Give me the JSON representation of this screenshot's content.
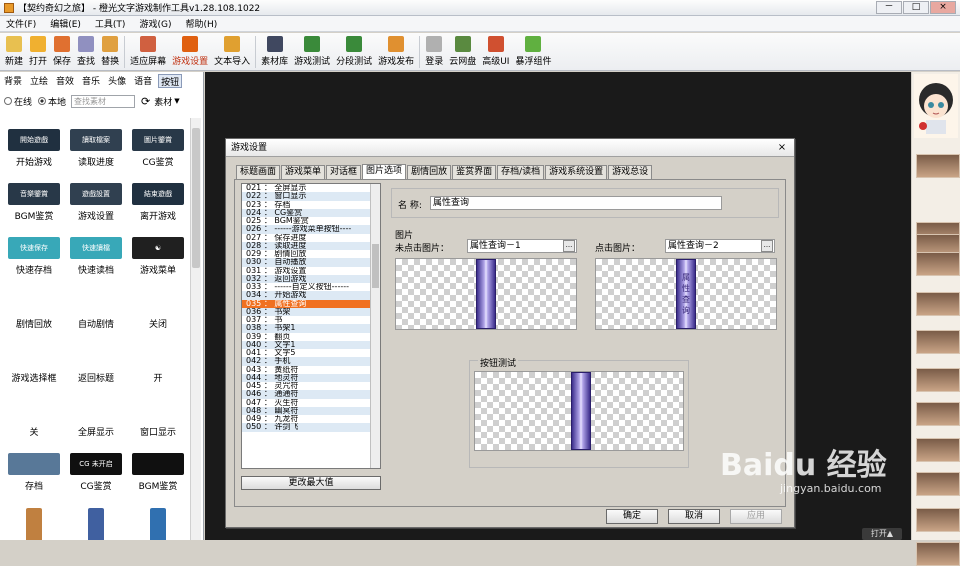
{
  "app": {
    "title": "【契约奇幻之旅】 - 橙光文字游戏制作工具v1.28.108.1022",
    "window_buttons": [
      "－",
      "□",
      "×"
    ]
  },
  "menu": [
    "文件(F)",
    "编辑(E)",
    "工具(T)",
    "游戏(G)",
    "帮助(H)"
  ],
  "toolbar": [
    {
      "label": "新建",
      "icon": "new-file-icon",
      "color": "#e8c050"
    },
    {
      "label": "打开",
      "icon": "open-folder-icon",
      "color": "#f0b030"
    },
    {
      "label": "保存",
      "icon": "save-icon",
      "color": "#e07030"
    },
    {
      "label": "查找",
      "icon": "find-icon",
      "color": "#9090c0"
    },
    {
      "label": "替换",
      "icon": "replace-icon",
      "color": "#e0a040"
    },
    {
      "label": "适应屏幕",
      "icon": "fit-screen-icon",
      "color": "#d06040"
    },
    {
      "label": "游戏设置",
      "icon": "gear-icon",
      "color": "#e06010"
    },
    {
      "label": "文本导入",
      "icon": "text-import-icon",
      "color": "#e0a030"
    },
    {
      "label": "素材库",
      "icon": "asset-library-icon",
      "color": "#404860"
    },
    {
      "label": "游戏测试",
      "icon": "game-test-icon",
      "color": "#3a8a3a"
    },
    {
      "label": "分段测试",
      "icon": "segment-test-icon",
      "color": "#3a8a3a"
    },
    {
      "label": "游戏发布",
      "icon": "publish-icon",
      "color": "#e09030"
    },
    {
      "label": "登录",
      "icon": "login-icon",
      "color": "#b0b0b0"
    },
    {
      "label": "云网盘",
      "icon": "cloud-drive-icon",
      "color": "#5a8a40"
    },
    {
      "label": "高级UI",
      "icon": "advanced-ui-icon",
      "color": "#d05030"
    },
    {
      "label": "暴浮组件",
      "icon": "component-icon",
      "color": "#60b040"
    }
  ],
  "left": {
    "categories": [
      "背景",
      "立绘",
      "音效",
      "音乐",
      "头像",
      "语音",
      "按钮"
    ],
    "active_category": "按钮",
    "source_online": "在线",
    "source_local": "本地",
    "search_placeholder": "查找素材",
    "material_dropdown": "素材",
    "materials": [
      {
        "label": "开始游戏",
        "thumb": "#203040",
        "text": "開始遊戲"
      },
      {
        "label": "读取进度",
        "thumb": "#304050",
        "text": "讀取檔案"
      },
      {
        "label": "CG鉴赏",
        "thumb": "#283848",
        "text": "圖片鑒賞"
      },
      {
        "label": "BGM鉴赏",
        "thumb": "#283848",
        "text": "音樂鑒賞"
      },
      {
        "label": "游戏设置",
        "thumb": "#304050",
        "text": "遊戲設置"
      },
      {
        "label": "离开游戏",
        "thumb": "#203040",
        "text": "結束遊戲"
      },
      {
        "label": "快速存档",
        "thumb": "#38a8b8",
        "text": "快速保存"
      },
      {
        "label": "快速读档",
        "thumb": "#38a8b8",
        "text": "快速讀檔"
      },
      {
        "label": "游戏菜单",
        "thumb": "#202020",
        "text": "☯"
      },
      {
        "label": "剧情回放",
        "thumb": "",
        "text": ""
      },
      {
        "label": "自动剧情",
        "thumb": "",
        "text": ""
      },
      {
        "label": "关闭",
        "thumb": "",
        "text": ""
      },
      {
        "label": "游戏选择框",
        "thumb": "",
        "text": ""
      },
      {
        "label": "返回标题",
        "thumb": "",
        "text": ""
      },
      {
        "label": "开",
        "thumb": "",
        "text": ""
      },
      {
        "label": "关",
        "thumb": "",
        "text": ""
      },
      {
        "label": "全屏显示",
        "thumb": "",
        "text": ""
      },
      {
        "label": "窗口显示",
        "thumb": "",
        "text": ""
      },
      {
        "label": "存档",
        "thumb": "#587898",
        "text": ""
      },
      {
        "label": "CG鉴赏",
        "thumb": "#101010",
        "text": "CG 未开启"
      },
      {
        "label": "BGM鉴赏",
        "thumb": "#101010",
        "text": ""
      },
      {
        "label": "",
        "thumb": "#c08040",
        "text": ""
      },
      {
        "label": "",
        "thumb": "#4060a0",
        "text": ""
      },
      {
        "label": "",
        "thumb": "#3070b0",
        "text": ""
      }
    ]
  },
  "dialog": {
    "title": "游戏设置",
    "close": "×",
    "tabs": [
      "标题画面",
      "游戏菜单",
      "对话框",
      "图片选项",
      "剧情回放",
      "鉴赏界面",
      "存档/读档",
      "游戏系统设置",
      "游戏总设"
    ],
    "active_tab": "图片选项",
    "list": [
      "021 ： 全屏显示",
      "022 ： 窗口显示",
      "023 ： 存档",
      "024 ： CG鉴赏",
      "025 ： BGM鉴赏",
      "026 ： ------游戏菜单按钮----",
      "027 ： 保存进度",
      "028 ： 读取进度",
      "029 ： 剧情回放",
      "030 ： 自动播放",
      "031 ： 游戏设置",
      "032 ： 返回游戏",
      "033 ： ------自定义按钮------",
      "034 ： 开始游戏",
      "035 ： 属性查询",
      "036 ： 书架",
      "037 ： 书",
      "038 ： 书架1",
      "039 ： 翻页",
      "040 ： 文字1",
      "041 ： 文字5",
      "042 ： 手机",
      "043 ： 黄纸符",
      "044 ： 地灵符",
      "045 ： 灵咒符",
      "046 ： 通通符",
      "047 ： 灭生符",
      "048 ： 幽冥符",
      "049 ： 九龙符",
      "050 ： 许剑飞"
    ],
    "selected_index": 14,
    "max_button": "更改最大值",
    "name_label": "名 称:",
    "name_value": "属性查询",
    "image_heading": "图片",
    "unclicked_label": "未点击图片：",
    "unclicked_value": "属性查询－1",
    "clicked_label": "点击图片：",
    "clicked_value": "属性查询－2",
    "browse": "...",
    "preview_text": [
      "属",
      "性",
      "查",
      "询"
    ],
    "test_label": "按钮测试",
    "ok": "确定",
    "cancel": "取消",
    "apply": "应用"
  },
  "watermark": {
    "main": "Baidu 经验",
    "sub": "jingyan.baidu.com"
  },
  "expand_button": "打开▲"
}
